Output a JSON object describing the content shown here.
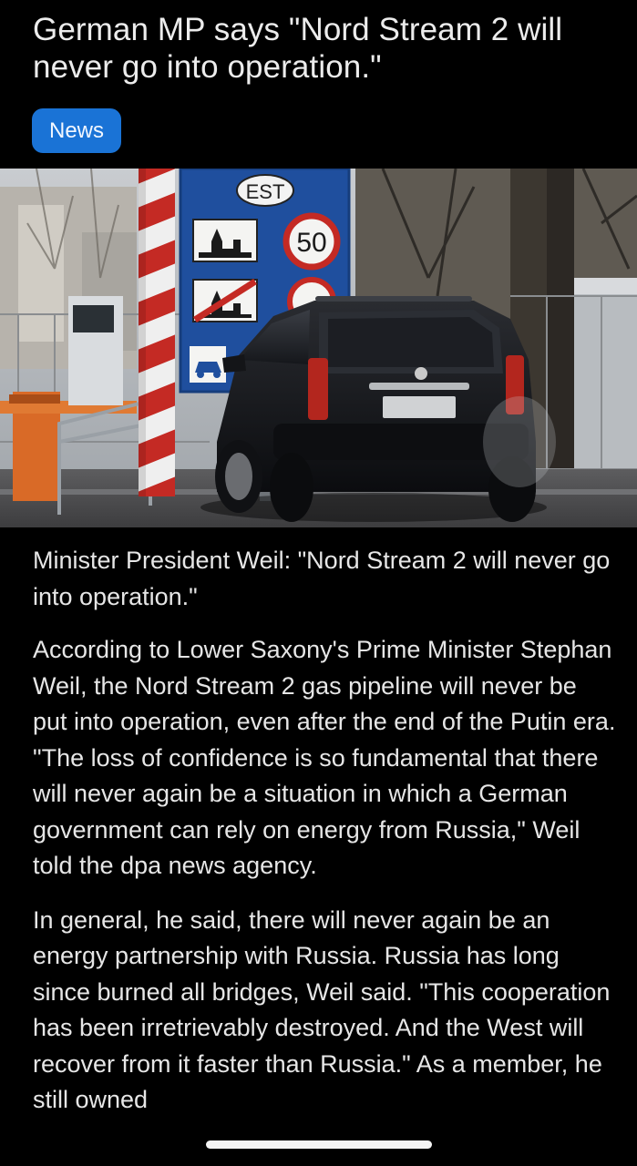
{
  "article": {
    "headline": "German MP says \"Nord Stream 2 will never go into operation.\"",
    "category": "News",
    "paragraphs": [
      "Minister President Weil: \"Nord Stream 2 will never go into operation.\"",
      "According to Lower Saxony's Prime Minister Stephan Weil, the Nord Stream 2 gas pipeline will never be put into operation, even after the end of the Putin era. \"The loss of confidence is so fundamental that there will never again be a situation in which a German government can rely on energy from Russia,\" Weil told the dpa news agency.",
      "In general, he said, there will never again be an energy partnership with Russia. Russia has long since burned all bridges, Weil said. \"This cooperation has been irretrievably destroyed. And the West will recover from it faster than Russia.\" As a member, he still owned"
    ]
  },
  "hero_image": {
    "sign_country_code": "EST",
    "speed_limit": "50"
  },
  "colors": {
    "background": "#000000",
    "pill": "#1a73d6",
    "text": "#e6e6e6"
  },
  "icons": {
    "home_indicator": "home-indicator-bar"
  }
}
